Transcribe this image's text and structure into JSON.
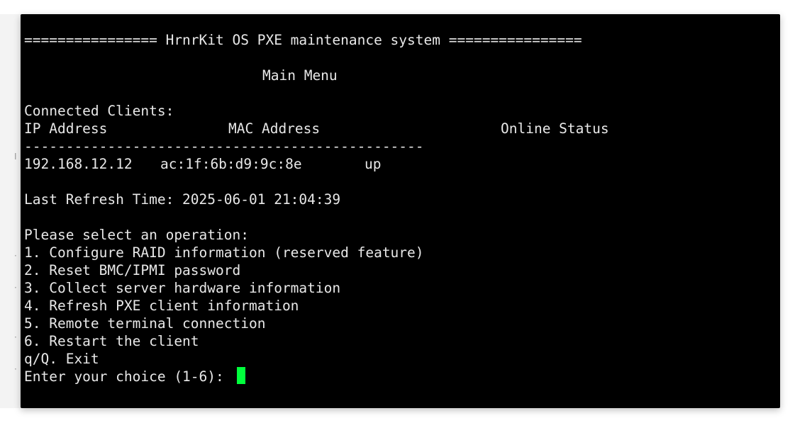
{
  "terminal": {
    "banner": "================ HrnrKit OS PXE maintenance system ================",
    "menu_title": "Main Menu",
    "clients_heading": "Connected Clients:",
    "table_header": {
      "ip": "IP Address",
      "mac": "MAC Address",
      "status": "Online Status"
    },
    "separator": "------------------------------------------------",
    "clients": [
      {
        "ip": "192.168.12.12",
        "mac": "ac:1f:6b:d9:9c:8e",
        "status": "up"
      }
    ],
    "refresh_label": "Last Refresh Time: 2025-06-01 21:04:39",
    "prompt_heading": "Please select an operation:",
    "options": [
      "1. Configure RAID information (reserved feature)",
      "2. Reset BMC/IPMI password",
      "3. Collect server hardware information",
      "4. Refresh PXE client information",
      "5. Remote terminal connection",
      "6. Restart the client",
      "q/Q. Exit"
    ],
    "input_prompt": "Enter your choice (1-6): ",
    "cursor_color": "#00ff3c"
  }
}
